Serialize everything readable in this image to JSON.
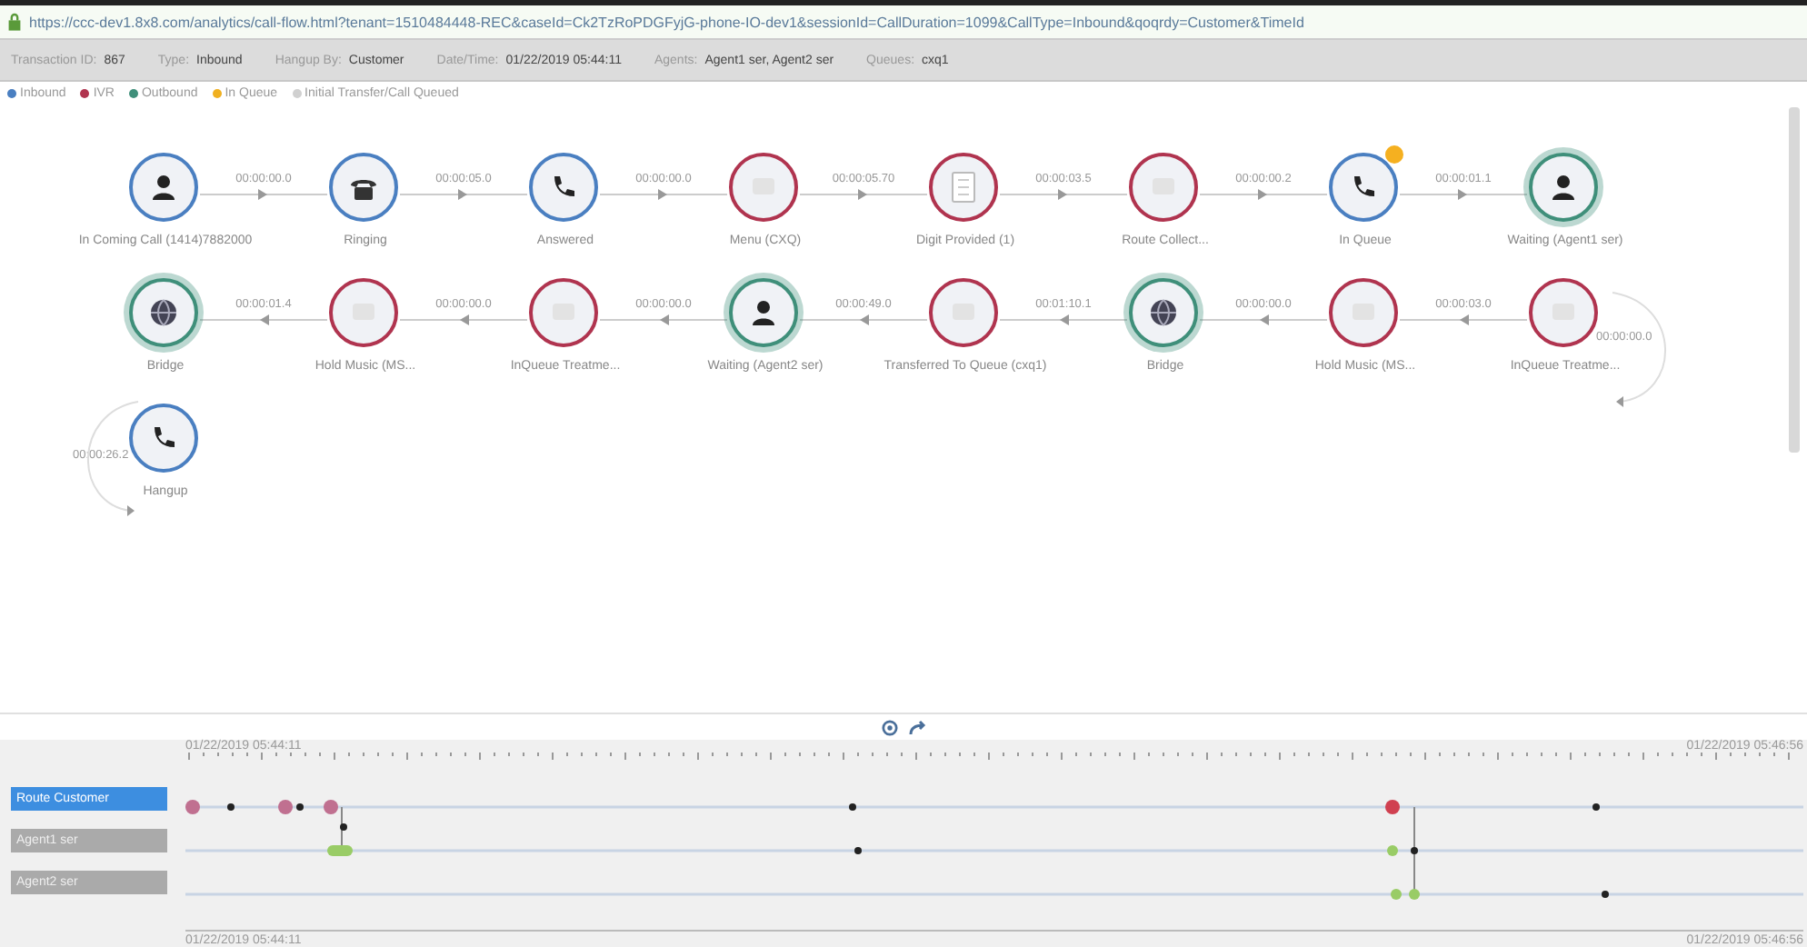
{
  "address_bar": {
    "url": "https://ccc-dev1.8x8.com/analytics/call-flow.html?tenant=1510484448-REC&caseId=Ck2TzRoPDGFyjG-phone-IO-dev1&sessionId=CallDuration=1099&CallType=Inbound&qoqrdy=Customer&TimeId"
  },
  "info_bar": [
    {
      "label": "Transaction ID:",
      "value": "867"
    },
    {
      "label": "Type:",
      "value": "Inbound"
    },
    {
      "label": "Hangup By:",
      "value": "Customer"
    },
    {
      "label": "Date/Time:",
      "value": "01/22/2019 05:44:11"
    },
    {
      "label": "Agents:",
      "value": "Agent1 ser, Agent2 ser"
    },
    {
      "label": "Queues:",
      "value": "cxq1"
    }
  ],
  "legend": [
    {
      "label": "Inbound",
      "color": "#4a7fc1"
    },
    {
      "label": "IVR",
      "color": "#b0344f"
    },
    {
      "label": "Outbound",
      "color": "#3f8f7a"
    },
    {
      "label": "In Queue",
      "color": "#f0b020"
    },
    {
      "label": "Initial Transfer/Call Queued",
      "color": "#d0d0d0"
    }
  ],
  "flow_rows": [
    {
      "nodes": [
        {
          "label": "In Coming Call (1414)7882000",
          "kind": "inbound",
          "badge": false,
          "duration": "00:00:00.0"
        },
        {
          "label": "Ringing",
          "kind": "inbound",
          "badge": false,
          "duration": "00:00:05.0"
        },
        {
          "label": "Answered",
          "kind": "inbound",
          "badge": false,
          "duration": "00:00:00.0"
        },
        {
          "label": "Menu (CXQ)",
          "kind": "ivr",
          "badge": false,
          "duration": "00:00:05.70"
        },
        {
          "label": "Digit Provided (1)",
          "kind": "ivr",
          "badge": false,
          "duration": "00:00:03.5"
        },
        {
          "label": "Route Collect...",
          "kind": "ivr",
          "badge": false,
          "duration": "00:00:00.2"
        },
        {
          "label": "In Queue",
          "kind": "inbound",
          "badge": true,
          "duration": "00:00:01.1"
        },
        {
          "label": "Waiting (Agent1 ser)",
          "kind": "outbound",
          "badge": false
        }
      ]
    },
    {
      "nodes": [
        {
          "label": "Bridge",
          "kind": "outbound",
          "badge": false,
          "duration": "00:00:01.4"
        },
        {
          "label": "Hold Music (MS...",
          "kind": "ivr",
          "badge": false,
          "duration": "00:00:00.0"
        },
        {
          "label": "InQueue Treatme...",
          "kind": "ivr",
          "badge": false,
          "duration": "00:00:00.0"
        },
        {
          "label": "Waiting (Agent2 ser)",
          "kind": "outbound",
          "badge": false,
          "duration": "00:00:49.0"
        },
        {
          "label": "Transferred To Queue (cxq1)",
          "kind": "ivr",
          "badge": false,
          "duration": "00:01:10.1"
        },
        {
          "label": "Bridge",
          "kind": "outbound",
          "badge": false,
          "duration": "00:00:00.0"
        },
        {
          "label": "Hold Music (MS...",
          "kind": "ivr",
          "badge": false,
          "duration": "00:00:03.0"
        },
        {
          "label": "InQueue Treatme...",
          "kind": "ivr",
          "badge": false
        }
      ]
    },
    {
      "nodes": [
        {
          "label": "Hangup",
          "kind": "inbound",
          "badge": false
        }
      ]
    }
  ],
  "row_links": [
    {
      "duration": "00:00:00.0"
    },
    {
      "duration": "00:00:26.2"
    }
  ],
  "timeline": {
    "start_time": "01/22/2019 05:44:11",
    "end_time": "01/22/2019 05:46:56",
    "bottom_start_time": "01/22/2019 05:44:11",
    "bottom_end_time": "01/22/2019 05:46:56",
    "lanes": [
      {
        "label": "Route Customer",
        "selected": true
      },
      {
        "label": "Agent1 ser",
        "selected": false
      },
      {
        "label": "Agent2 ser",
        "selected": false
      }
    ]
  }
}
